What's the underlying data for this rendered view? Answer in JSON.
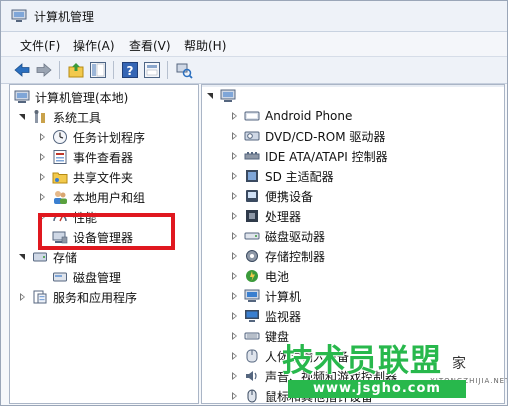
{
  "window": {
    "title": "计算机管理"
  },
  "menu": [
    "文件(F)",
    "操作(A)",
    "查看(V)",
    "帮助(H)"
  ],
  "toolbar": [
    "back-arrow-icon",
    "forward-arrow-icon",
    "up-folder-icon",
    "show-hide-tree-icon",
    "help-icon",
    "properties-icon",
    "scan-hardware-icon"
  ],
  "left_tree": {
    "root": "计算机管理(本地)",
    "system_tools": "系统工具",
    "task_scheduler": "任务计划程序",
    "event_viewer": "事件查看器",
    "shared_folders": "共享文件夹",
    "local_users": "本地用户和组",
    "performance": "性能",
    "device_manager": "设备管理器",
    "storage": "存储",
    "disk_management": "磁盘管理",
    "services_apps": "服务和应用程序"
  },
  "right_tree": {
    "computer_name": "",
    "items": [
      "Android Phone",
      "DVD/CD-ROM 驱动器",
      "IDE ATA/ATAPI 控制器",
      "SD 主适配器",
      "便携设备",
      "处理器",
      "磁盘驱动器",
      "存储控制器",
      "电池",
      "计算机",
      "监视器",
      "键盘",
      "人体学输入设备",
      "声音、视频和游戏控制器",
      "鼠标和其他指针设备"
    ]
  },
  "watermark": {
    "brand": "技术员联盟",
    "tail": "家",
    "url": "www.jsgho.com",
    "small": "XITONGZHIJIA.NET"
  },
  "colors": {
    "highlight": "#e0181f",
    "watermark_green": "#28b84c",
    "arrow_blue": "#2a6fbf"
  }
}
